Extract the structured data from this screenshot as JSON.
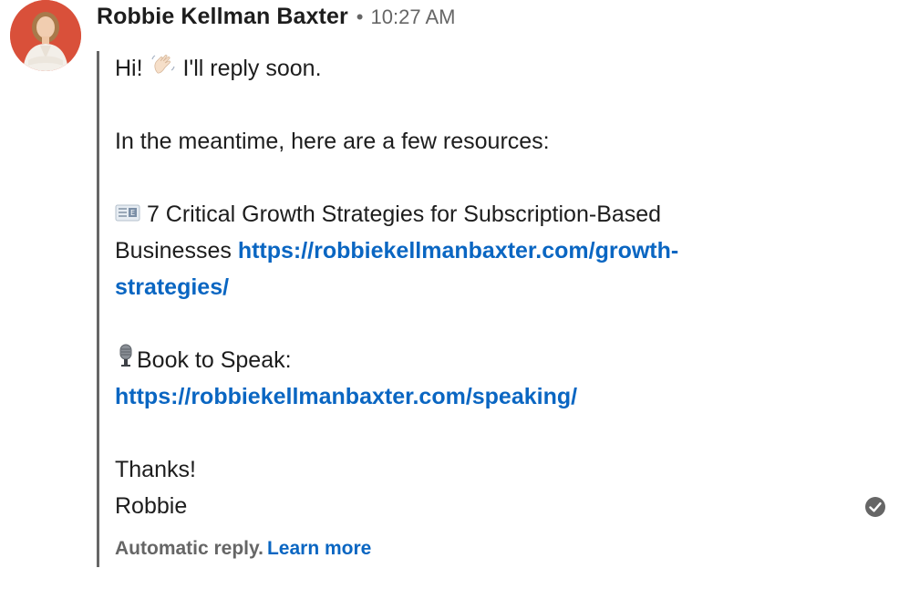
{
  "message": {
    "sender_name": "Robbie Kellman Baxter",
    "separator": "•",
    "timestamp": "10:27 AM",
    "avatar_icon": "profile-photo",
    "lines": {
      "greeting_prefix": "Hi!",
      "greeting_emoji": "waving-hand-emoji",
      "greeting_suffix": "I'll reply soon.",
      "intro": "In the meantime, here are a few resources:",
      "resource1_emoji": "newspaper-envelope-emoji",
      "resource1_text_a": "7 Critical Growth Strategies for Subscription-Based",
      "resource1_text_b": "Businesses",
      "resource1_link_a": "https://robbiekellmanbaxter.com/growth-",
      "resource1_link_b": "strategies/",
      "resource2_emoji": "microphone-emoji",
      "resource2_text": "Book to Speak:",
      "resource2_link": "https://robbiekellmanbaxter.com/speaking/",
      "closing": "Thanks!",
      "signature": "Robbie"
    },
    "footer": {
      "note": "Automatic reply.",
      "learn_more": "Learn more"
    },
    "status_icon": "read-check-icon"
  },
  "colors": {
    "link": "#0a66c2",
    "muted": "#666666",
    "text": "#1d1d1d",
    "avatar_bg": "#d9503a"
  }
}
